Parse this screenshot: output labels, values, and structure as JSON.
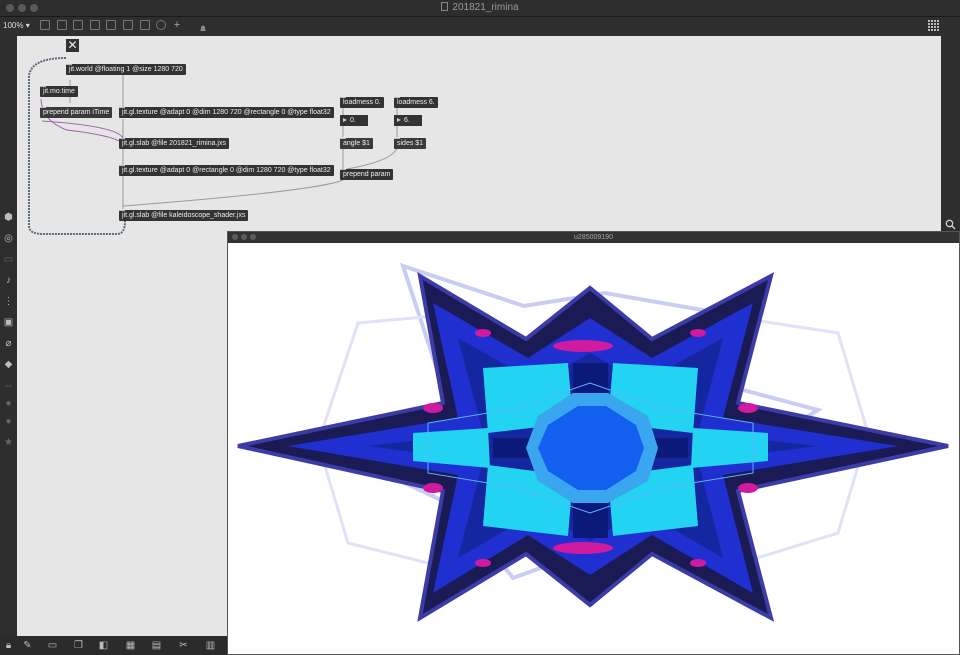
{
  "window": {
    "title": "201821_rimina"
  },
  "toolbar": {
    "zoom": "100%",
    "zoom_caret": "▾"
  },
  "patch": {
    "objects": {
      "jit_world": "jit.world @floating 1 @size 1280 720",
      "jit_mo_time": "jit.mo.time",
      "prepend_itime": "prepend param iTime",
      "tex1": "jit.gl.texture @adapt 0 @dim 1280 720 @rectangle 0 @type float32",
      "slab1": "jit.gl.slab @file 201821_rimina.jxs",
      "tex2": "jit.gl.texture @adapt 0 @rectangle 0 @dim 1280 720 @type float32",
      "slab2": "jit.gl.slab @file kaleidoscope_shader.jxs",
      "loadmess_angle": "loadmess 0.",
      "loadmess_sides": "loadmess 6.",
      "num_angle": "0.",
      "num_sides": "6.",
      "msg_angle": "angle $1",
      "msg_sides": "sides $1",
      "prepend_param": "prepend param"
    },
    "toggle_glyph": "✕"
  },
  "output_window": {
    "title": "u285009190"
  },
  "colors": {
    "star_outer": "#1a1a55",
    "star_mid": "#1f2fd0",
    "hex_cyan": "#22d4f2",
    "center": "#1160f0",
    "magenta": "#d01aa0"
  }
}
